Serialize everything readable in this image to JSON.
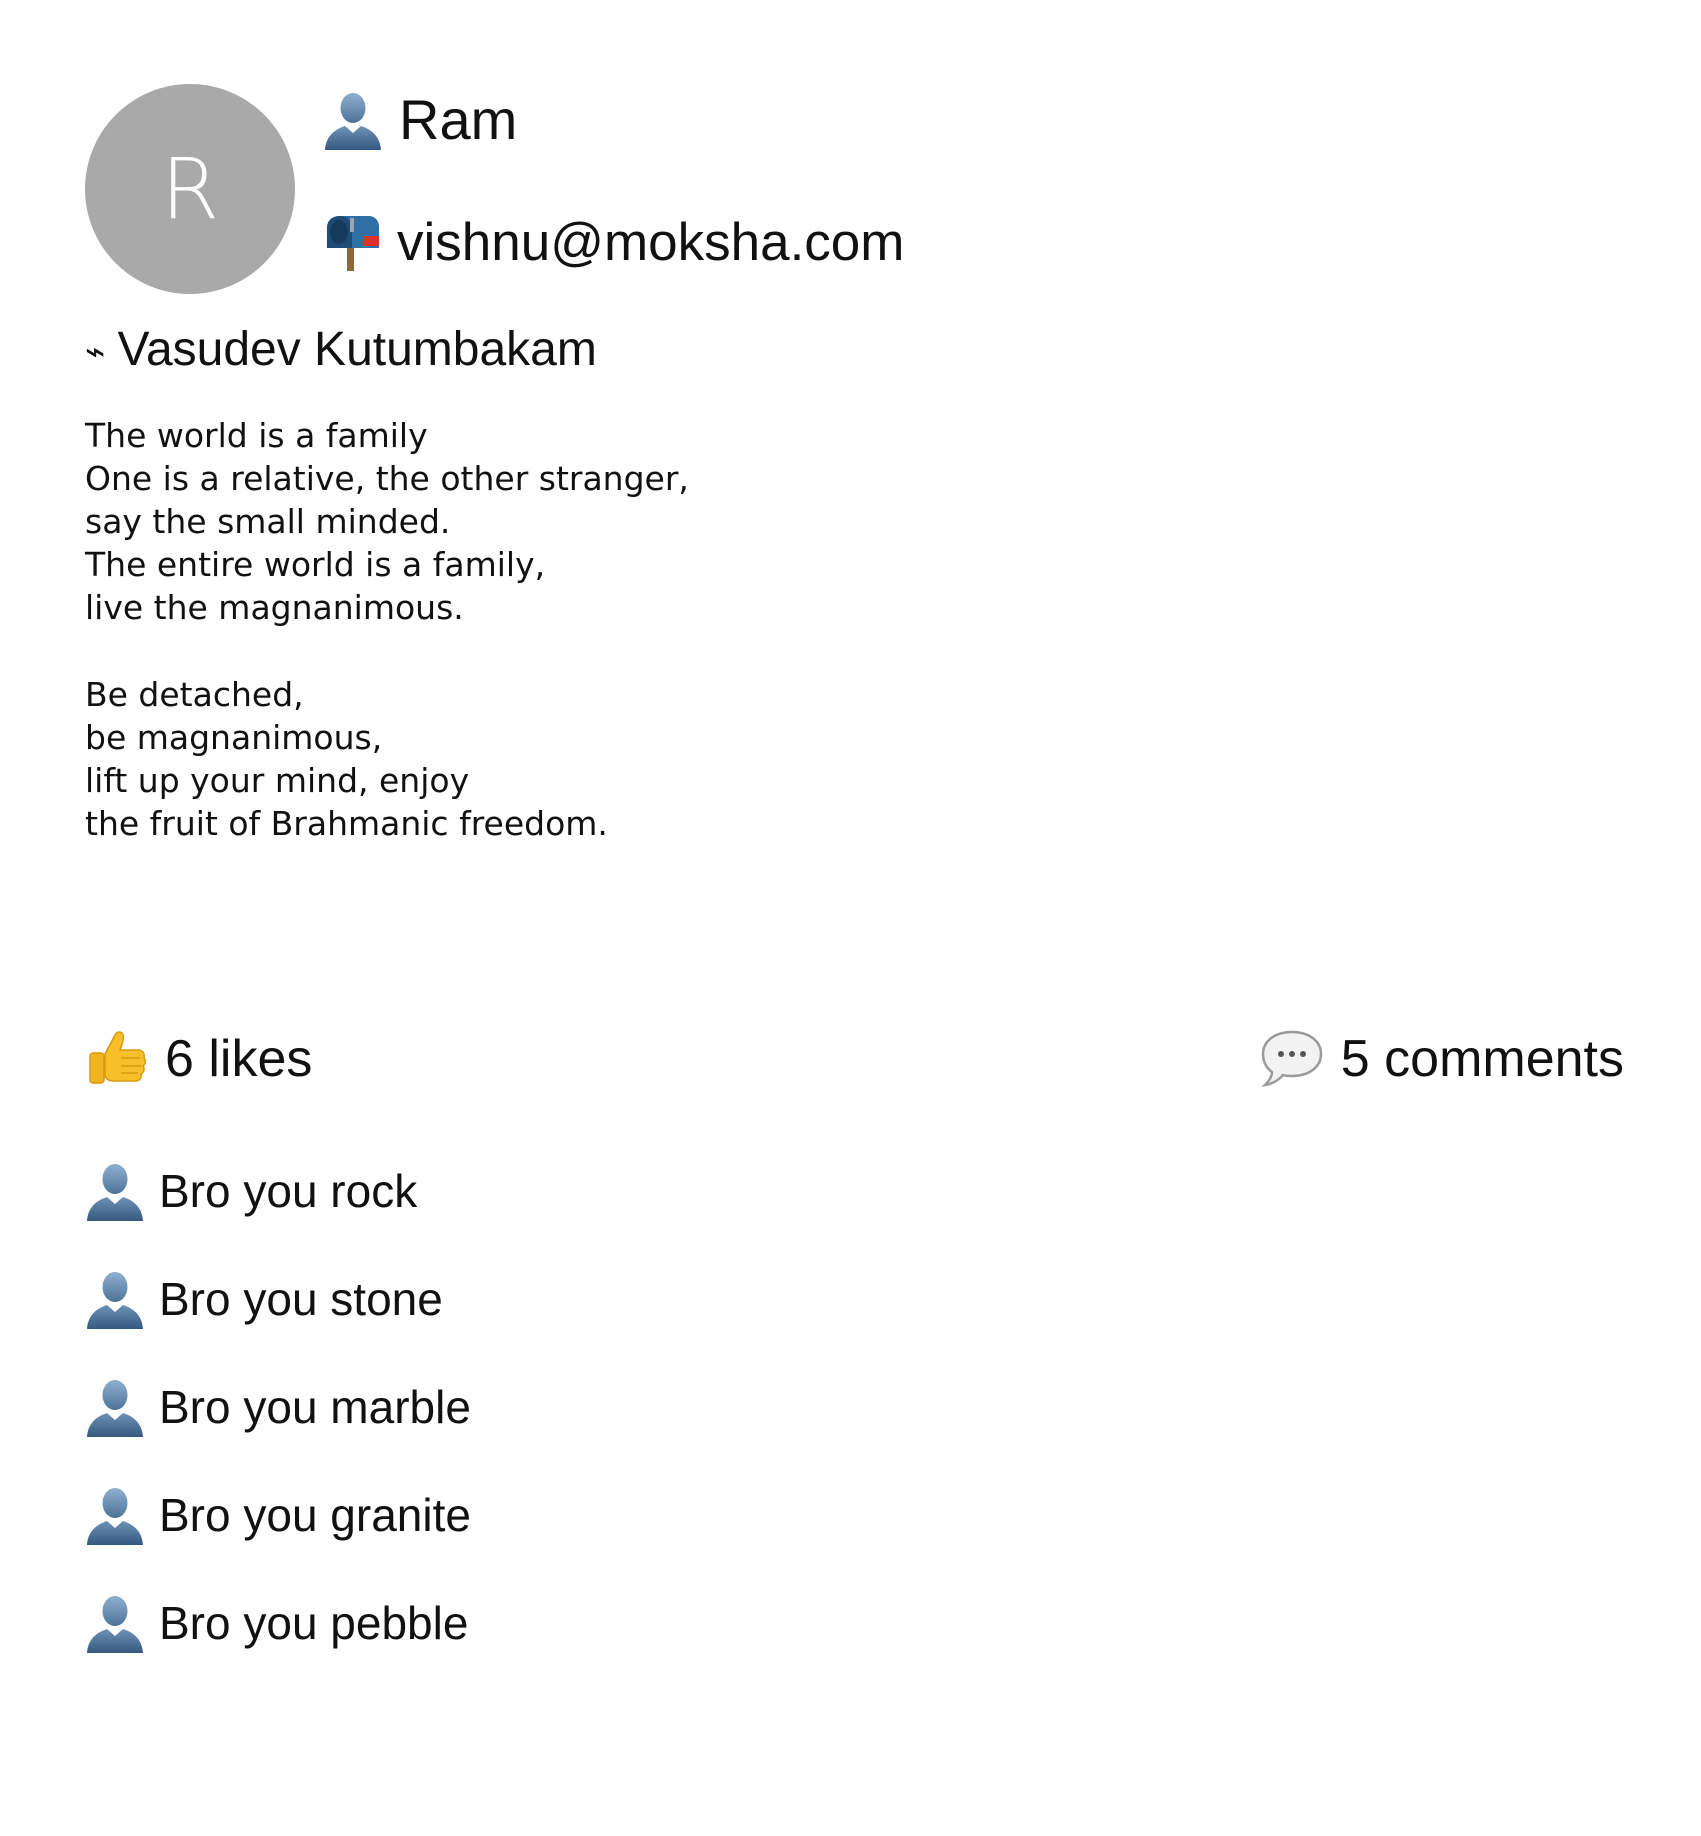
{
  "profile": {
    "avatar_initial": "R",
    "avatar_color": "#a9a9a9",
    "user_icon": "bust-in-silhouette-icon",
    "name": "Ram",
    "email_icon": "mailbox-icon",
    "email": "vishnu@moksha.com"
  },
  "post": {
    "title_icon": "⌁",
    "title": "Vasudev Kutumbakam",
    "stanzas": [
      [
        "The world is a family",
        "One is a relative, the other stranger,",
        "say the small minded.",
        "The entire world is a family,",
        "live the magnanimous."
      ],
      [
        "Be detached,",
        "be magnanimous,",
        "lift up your mind, enjoy",
        "the fruit of Brahmanic freedom."
      ]
    ]
  },
  "stats": {
    "likes_icon": "thumbs-up-icon",
    "likes_label": "6 likes",
    "comments_icon": "speech-bubble-icon",
    "comments_label": "5 comments"
  },
  "comments": [
    {
      "icon": "bust-in-silhouette-icon",
      "text": "Bro you rock"
    },
    {
      "icon": "bust-in-silhouette-icon",
      "text": "Bro you stone"
    },
    {
      "icon": "bust-in-silhouette-icon",
      "text": "Bro you marble"
    },
    {
      "icon": "bust-in-silhouette-icon",
      "text": "Bro you granite"
    },
    {
      "icon": "bust-in-silhouette-icon",
      "text": "Bro you pebble"
    }
  ]
}
